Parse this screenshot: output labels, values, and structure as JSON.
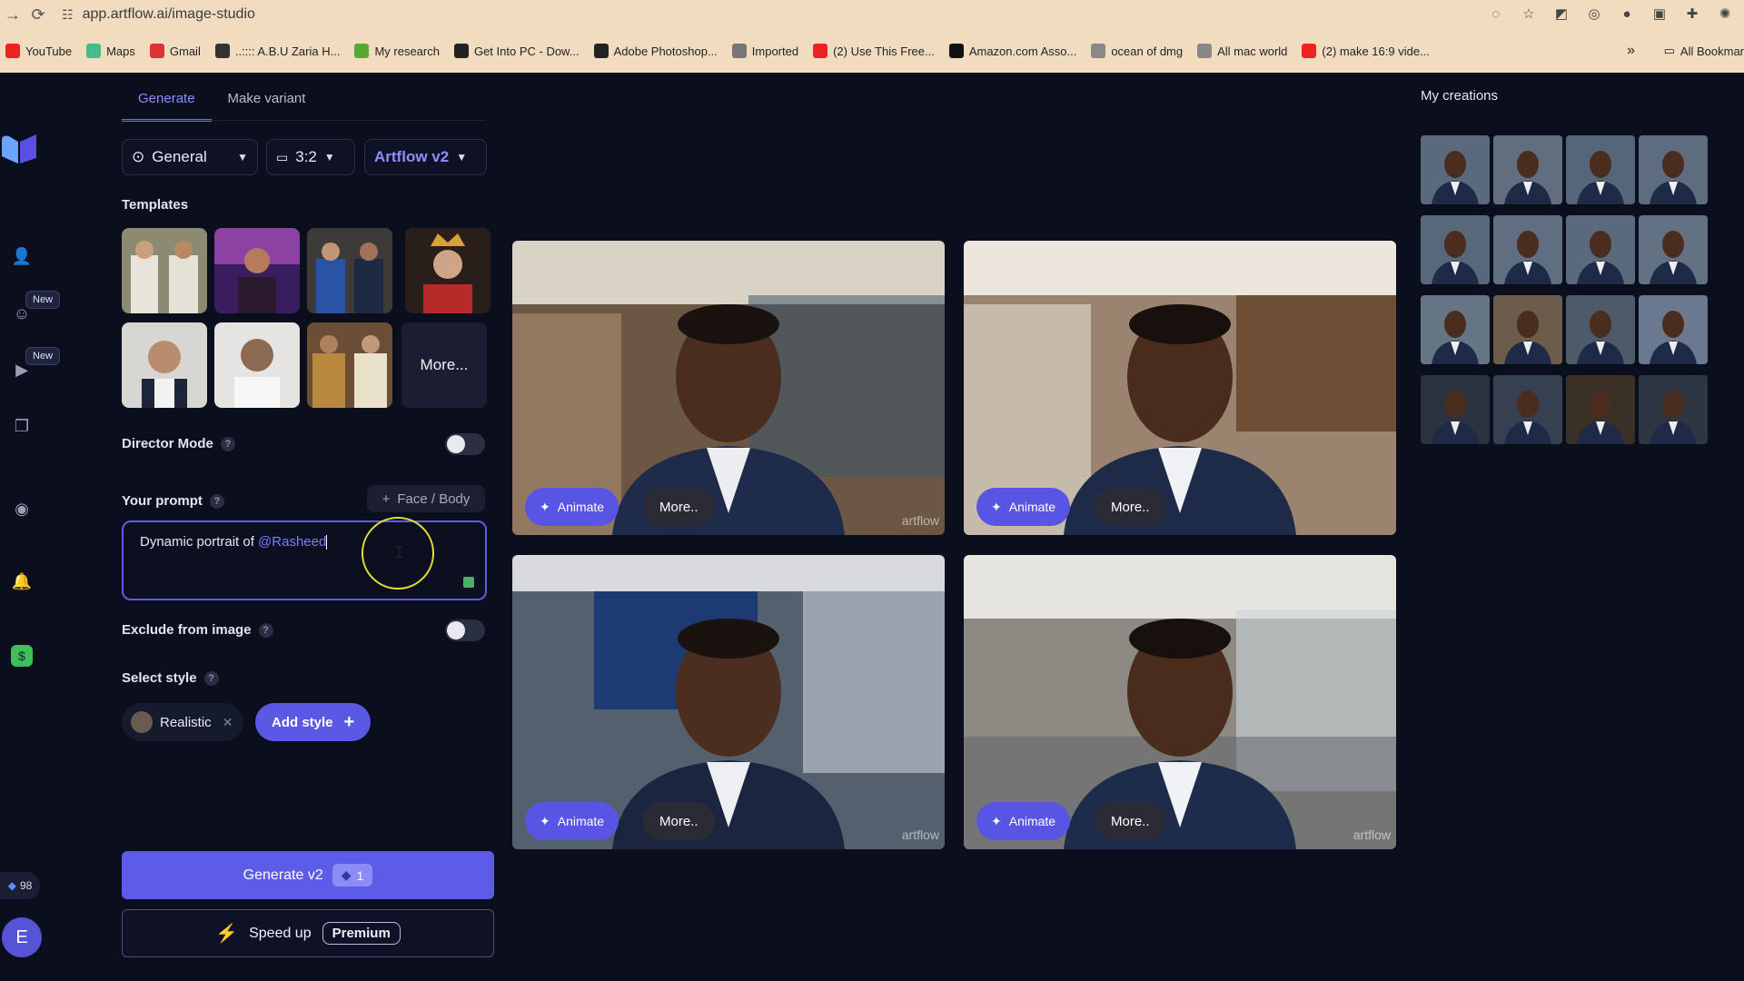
{
  "browser": {
    "url": "app.artflow.ai/image-studio",
    "bookmarks": [
      {
        "label": "YouTube",
        "icon": "youtube-icon",
        "color": "#e22"
      },
      {
        "label": "Maps",
        "icon": "maps-pin-icon",
        "color": "#4b8"
      },
      {
        "label": "Gmail",
        "icon": "gmail-icon",
        "color": "#d33"
      },
      {
        "label": "..:::: A.B.U Zaria H...",
        "icon": "site-icon",
        "color": "#333"
      },
      {
        "label": "My research",
        "icon": "research-icon",
        "color": "#5a3"
      },
      {
        "label": "Get Into PC - Dow...",
        "icon": "site-icon",
        "color": "#222"
      },
      {
        "label": "Adobe Photoshop...",
        "icon": "site-icon",
        "color": "#222"
      },
      {
        "label": "Imported",
        "icon": "folder-icon",
        "color": "#777"
      },
      {
        "label": "(2) Use This Free...",
        "icon": "youtube-icon",
        "color": "#e22"
      },
      {
        "label": "Amazon.com Asso...",
        "icon": "amazon-icon",
        "color": "#111"
      },
      {
        "label": "ocean of dmg",
        "icon": "site-icon",
        "color": "#888"
      },
      {
        "label": "All mac world",
        "icon": "site-icon",
        "color": "#888"
      },
      {
        "label": "(2) make 16:9 vide...",
        "icon": "youtube-icon",
        "color": "#e22"
      }
    ],
    "all_bookmarks": "All Bookmar",
    "more": "»"
  },
  "rail": {
    "new_badge_1": "New",
    "new_badge_2": "New",
    "credits": "98",
    "avatar": "E"
  },
  "tabs": {
    "generate": "Generate",
    "make_variant": "Make variant"
  },
  "selectors": {
    "mode": "General",
    "ratio": "3:2",
    "model": "Artflow v2"
  },
  "templates": {
    "title": "Templates",
    "more": "More..."
  },
  "director_mode": {
    "label": "Director Mode",
    "on": false
  },
  "prompt": {
    "label": "Your prompt",
    "face_body": "Face / Body",
    "text": "Dynamic portrait of ",
    "mention": "@Rasheed"
  },
  "exclude": {
    "label": "Exclude from image",
    "on": false
  },
  "style": {
    "label": "Select style",
    "chip": "Realistic",
    "add": "Add style"
  },
  "generate": {
    "label": "Generate v2",
    "cost": "1"
  },
  "speed": {
    "label": "Speed up",
    "premium": "Premium"
  },
  "results": {
    "animate": "Animate",
    "more": "More..",
    "watermark": "artflow"
  },
  "my_creations": {
    "title": "My creations"
  },
  "colors": {
    "accent": "#5d5ce8",
    "bg": "#0b0e1c"
  }
}
